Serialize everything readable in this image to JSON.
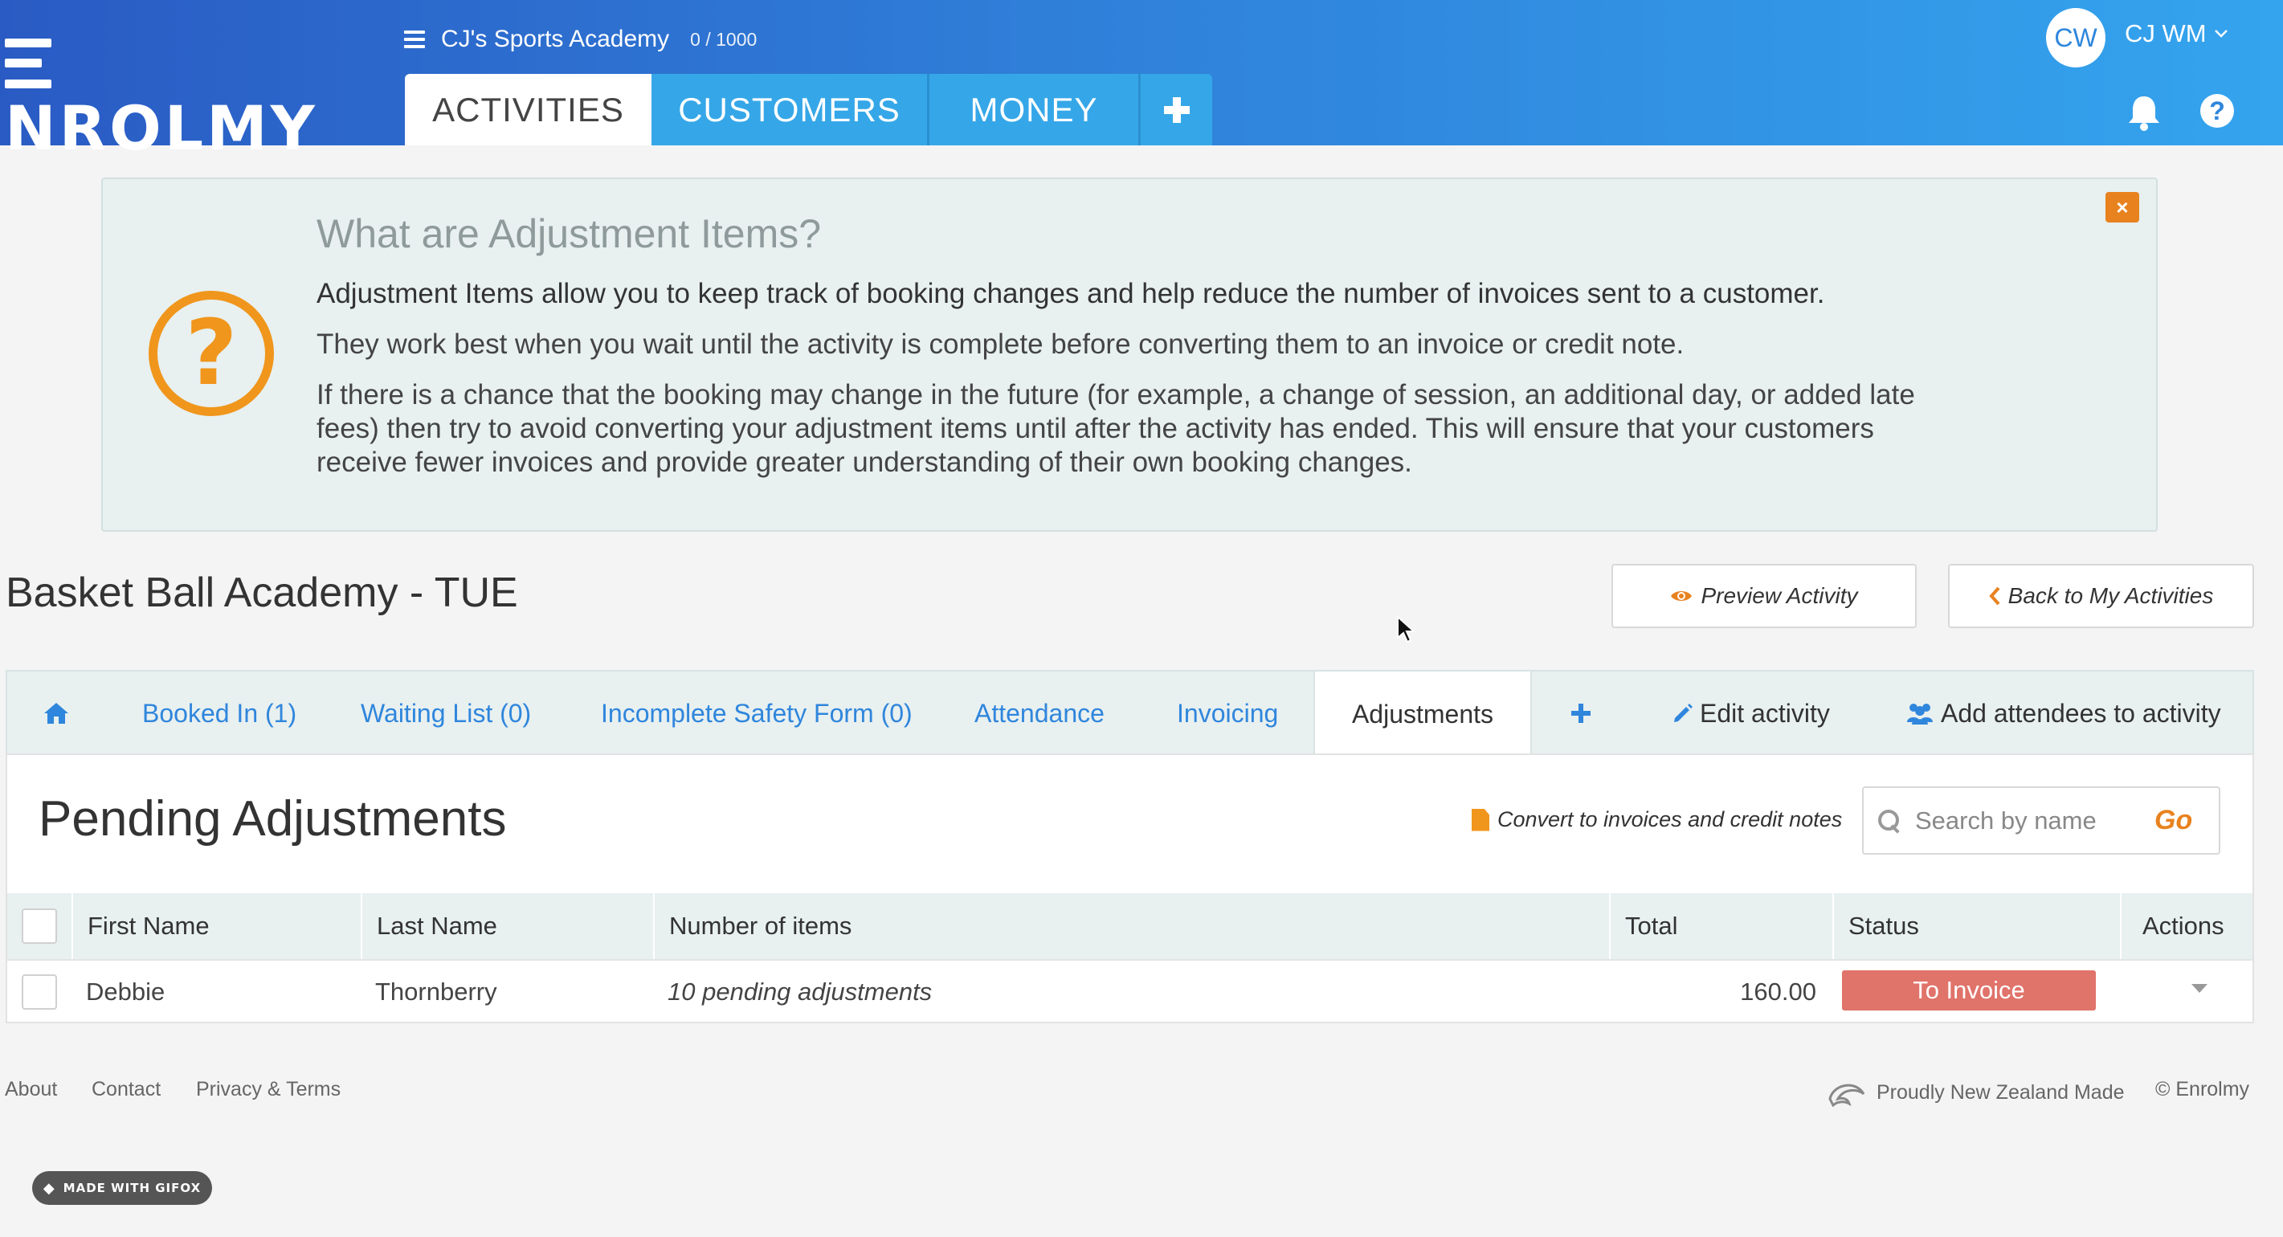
{
  "header": {
    "logo_text": "ENROLMY",
    "org_name": "CJ's Sports Academy",
    "org_count": "0 / 1000",
    "main_tabs": [
      {
        "label": "ACTIVITIES",
        "active": true
      },
      {
        "label": "CUSTOMERS",
        "active": false
      },
      {
        "label": "MONEY",
        "active": false
      },
      {
        "label": "+",
        "icon": "plus-icon"
      }
    ],
    "user_initials": "CW",
    "user_name": "CJ WM",
    "icons": {
      "menu": "hamburger-icon",
      "bell": "bell-icon",
      "help": "help-icon",
      "user_menu": "chevron-down-icon"
    }
  },
  "info_panel": {
    "title": "What are Adjustment Items?",
    "lead": "Adjustment Items allow you to keep track of booking changes and help reduce the number of invoices sent to a customer.",
    "p2": "They work best when you wait until the activity is complete before converting them to an invoice or credit note.",
    "p3": "If there is a chance that the booking may change in the future (for example, a change of session, an additional day, or added late fees) then try to avoid converting your adjustment items until after the activity has ended. This will ensure that your customers receive fewer invoices and provide greater understanding of their own booking changes.",
    "icon": "question-circle-icon",
    "close_icon": "close-icon",
    "close_label": "×"
  },
  "activity": {
    "title": "Basket Ball Academy - TUE",
    "preview_label": "Preview Activity",
    "back_label": "Back to My Activities"
  },
  "sub_tabs": [
    {
      "label": "",
      "icon": "home-icon"
    },
    {
      "label": "Booked In (1)"
    },
    {
      "label": "Waiting List (0)"
    },
    {
      "label": "Incomplete Safety Form (0)"
    },
    {
      "label": "Attendance"
    },
    {
      "label": "Invoicing"
    },
    {
      "label": "Adjustments",
      "active": true
    },
    {
      "label": "+",
      "icon": "plus-icon"
    },
    {
      "label": "Edit activity",
      "icon": "pencil-icon"
    },
    {
      "label": "Add attendees to activity",
      "icon": "users-icon"
    }
  ],
  "adjustments": {
    "title": "Pending Adjustments",
    "convert_label": "Convert to invoices and credit notes",
    "search_placeholder": "Search by name",
    "go_label": "Go",
    "columns": [
      "First Name",
      "Last Name",
      "Number of items",
      "Total",
      "Status",
      "Actions"
    ],
    "rows": [
      {
        "first_name": "Debbie",
        "last_name": "Thornberry",
        "items": "10 pending adjustments",
        "total": "160.00",
        "status": "To Invoice"
      }
    ]
  },
  "footer": {
    "links": [
      "About",
      "Contact",
      "Privacy & Terms"
    ],
    "nz_made": "Proudly New Zealand Made",
    "copyright": "© Enrolmy",
    "gifox": "MADE WITH GIFOX"
  },
  "colors": {
    "brand_blue": "#2f86dc",
    "accent_orange": "#e8821f",
    "status_red": "#e0736a",
    "panel_bg": "#e8f0f0"
  }
}
